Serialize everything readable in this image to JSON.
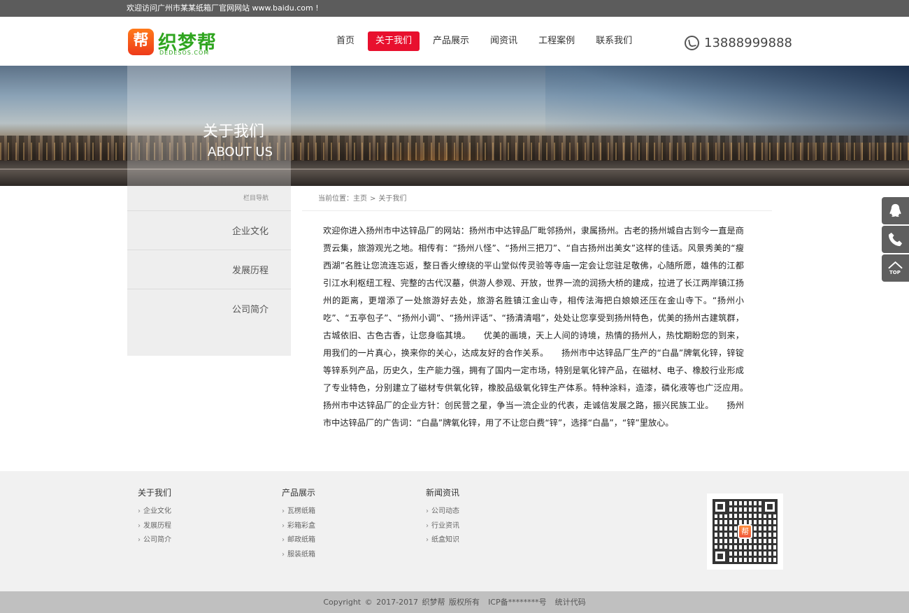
{
  "topbar": {
    "welcome": "欢迎访问广州市某某纸箱厂官网网站 www.baidu.com !"
  },
  "header": {
    "logo_badge": "帮",
    "logo_text": "织梦帮",
    "logo_sub": "DEDESOS.COM",
    "phone": "13888999888"
  },
  "nav": [
    {
      "label": "首页"
    },
    {
      "label": "关于我们"
    },
    {
      "label": "产品展示"
    },
    {
      "label": "闻资讯"
    },
    {
      "label": "工程案例"
    },
    {
      "label": "联系我们"
    }
  ],
  "banner": {
    "title": "关于我们",
    "subtitle": "ABOUT US"
  },
  "sidebar": {
    "heading": "栏目导航",
    "items": [
      {
        "label": "企业文化"
      },
      {
        "label": "发展历程"
      },
      {
        "label": "公司简介"
      }
    ]
  },
  "breadcrumb": {
    "prefix": "当前位置：",
    "home": "主页",
    "sep": ">",
    "current": "关于我们"
  },
  "article": {
    "text": "欢迎你进入扬州市中达锌品厂的网站：扬州市中达锌品厂毗邻扬州，隶属扬州。古老的扬州城自古到今一直是商贾云集，旅游观光之地。相传有：“扬州八怪”、“扬州三把刀”、“自古扬州出美女”这样的佳话。风景秀美的“瘦西湖”名胜让您流连忘返，整日香火缭绕的平山堂似传灵验等寺庙一定会让您驻足敬佛，心随所愿，雄伟的江都引江水利枢纽工程、完整的古代汉墓，供游人参观、开放，世界一流的润扬大桥的建成，拉进了长江两岸镇江扬州的距离，更增添了一处旅游好去处，旅游名胜镇江金山寺，相传法海把白娘娘还压在金山寺下。“扬州小吃”、“五亭包子”、“扬州小调”、“扬州评话”、“扬清清唱”，处处让您享受到扬州特色，优美的扬州古建筑群，古城依旧、古色古香，让您身临其境。　　优美的画境，天上人间的诗境，热情的扬州人，热忱期盼您的到来，用我们的一片真心，换来你的关心，达成友好的合作关系。　　扬州市中达锌品厂生产的“白晶”牌氧化锌，锌锭等锌系列产品，历史久，生产能力强，拥有了国内一定市场，特别是氧化锌产品，在磁材、电子、橡胶行业形成了专业特色，分别建立了磁材专供氧化锌，橡胶品级氧化锌生产体系。特种涂料，造漆，磷化液等也广泛应用。　　扬州市中达锌品厂的企业方针：创民营之星，争当一流企业的代表，走诚信发展之路，振兴民族工业。　　扬州市中达锌品厂的广告词：“白晶”牌氧化锌，用了不让您白费“锌”，选择“白晶”，“锌”里放心。"
  },
  "footer": {
    "columns": [
      {
        "title": "关于我们",
        "items": [
          "企业文化",
          "发展历程",
          "公司简介"
        ]
      },
      {
        "title": "产品展示",
        "items": [
          "瓦楞纸箱",
          "彩箱彩盒",
          "邮政纸箱",
          "服装纸箱"
        ]
      },
      {
        "title": "新闻资讯",
        "items": [
          "公司动态",
          "行业资讯",
          "纸盒知识"
        ]
      }
    ],
    "qr_logo": "帮"
  },
  "copyright": {
    "text": "Copyright © 2017-2017 织梦帮 版权所有",
    "icp": "ICP备********号",
    "stats": "统计代码"
  },
  "floatbar": {
    "top_label": "TOP"
  }
}
